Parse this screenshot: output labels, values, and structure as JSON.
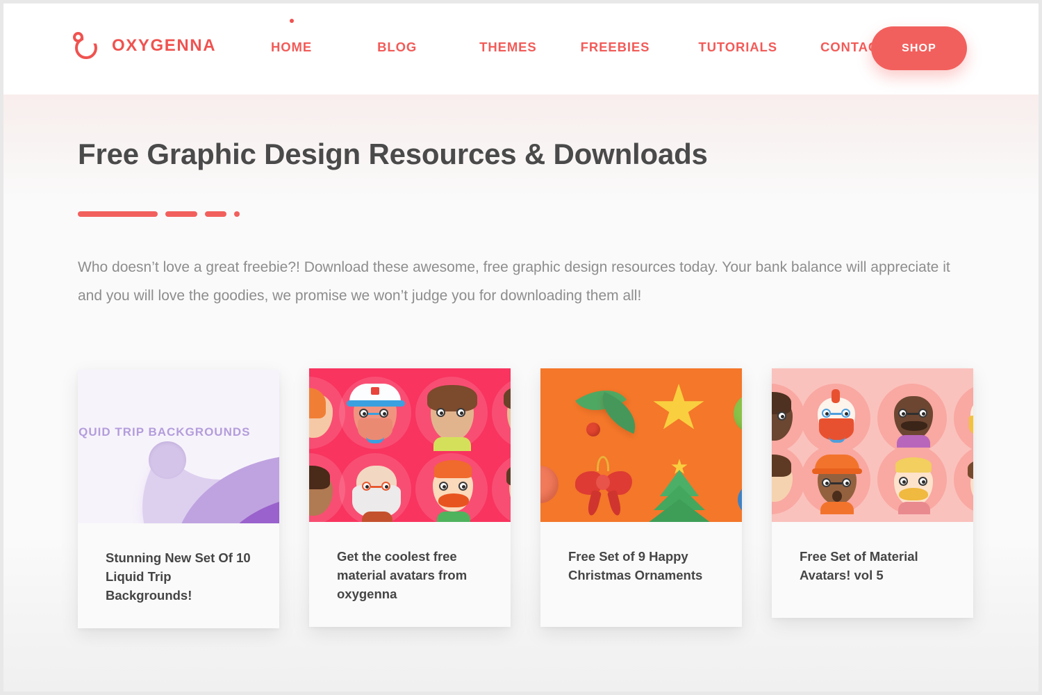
{
  "brand": {
    "name": "OXYGENNA",
    "logo_icon": "oxygenna-ring-logo-icon",
    "accent_color": "#ef5350"
  },
  "nav": {
    "items": [
      {
        "label": "HOME",
        "active": true
      },
      {
        "label": "BLOG",
        "active": false
      },
      {
        "label": "THEMES",
        "active": false
      },
      {
        "label": "FREEBIES",
        "active": false
      },
      {
        "label": "TUTORIALS",
        "active": false
      },
      {
        "label": "CONTACT",
        "active": false
      }
    ],
    "shop_button_label": "SHOP",
    "shop_button_color": "#f2605d"
  },
  "hero": {
    "title": "Free Graphic Design Resources & Downloads",
    "divider_color": "#f2605d",
    "lede": "Who doesn’t love a great freebie?! Download these awesome, free graphic design resources today. Your bank balance will appreciate it and you will love the goodies, we promise we won’t judge you for downloading them all!"
  },
  "cards": [
    {
      "title": "Stunning New Set Of 10 Liquid Trip Backgrounds!",
      "thumb_label": "LIQUID TRIP BACKGROUNDS",
      "thumb_kind": "liquid-paper-cut",
      "thumb_bg": "#f7f3fb"
    },
    {
      "title": "Get the coolest free material avatars from oxygenna",
      "thumb_kind": "avatar-pattern",
      "thumb_bg": "#f8345f"
    },
    {
      "title": "Free Set of 9 Happy Christmas Ornaments",
      "thumb_kind": "christmas-ornaments",
      "thumb_bg": "#f4772a"
    },
    {
      "title": "Free Set of Material Avatars! vol 5",
      "thumb_kind": "avatar-pattern-light",
      "thumb_bg": "#fac2bd"
    }
  ]
}
